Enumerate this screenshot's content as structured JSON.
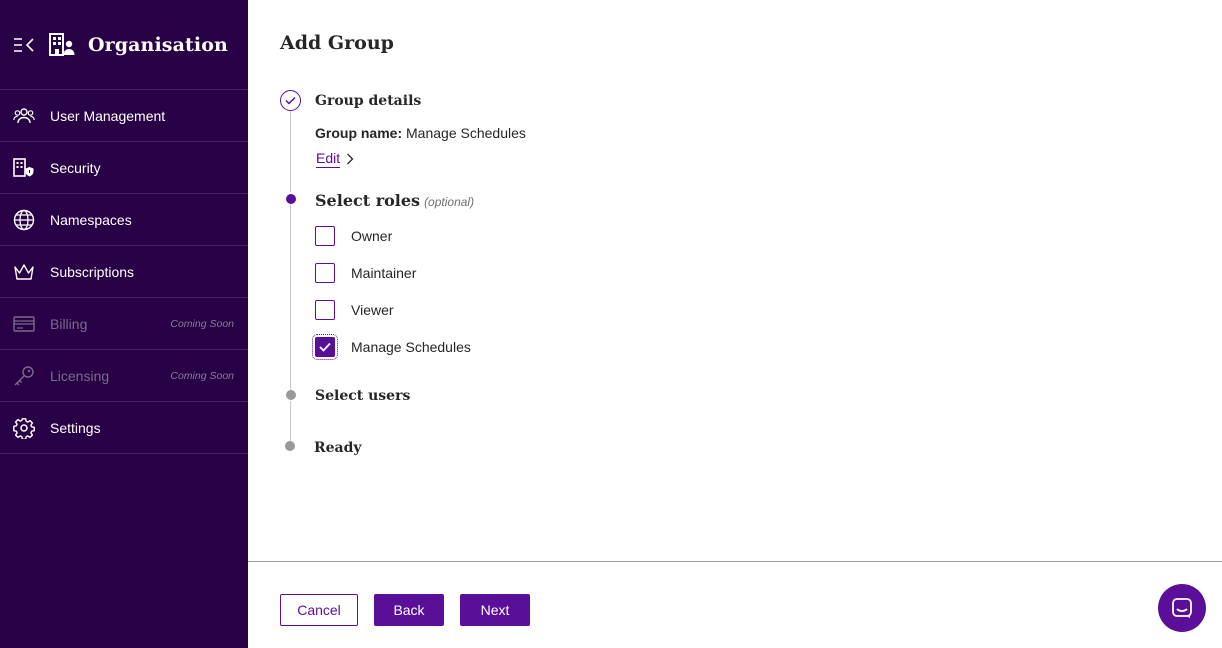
{
  "sidebar": {
    "title": "Organisation",
    "items": [
      {
        "label": "User Management",
        "icon": "users-icon",
        "disabled": false,
        "badge": ""
      },
      {
        "label": "Security",
        "icon": "building-shield-icon",
        "disabled": false,
        "badge": ""
      },
      {
        "label": "Namespaces",
        "icon": "globe-icon",
        "disabled": false,
        "badge": ""
      },
      {
        "label": "Subscriptions",
        "icon": "crown-icon",
        "disabled": false,
        "badge": ""
      },
      {
        "label": "Billing",
        "icon": "credit-card-icon",
        "disabled": true,
        "badge": "Coming Soon"
      },
      {
        "label": "Licensing",
        "icon": "key-icon",
        "disabled": true,
        "badge": "Coming Soon"
      },
      {
        "label": "Settings",
        "icon": "gear-icon",
        "disabled": false,
        "badge": ""
      }
    ]
  },
  "page": {
    "title": "Add Group"
  },
  "steps": {
    "group_details": {
      "title": "Group details",
      "group_name_label": "Group name:",
      "group_name_value": "Manage Schedules",
      "edit_label": "Edit"
    },
    "select_roles": {
      "title": "Select roles",
      "optional_label": "(optional)",
      "roles": [
        {
          "label": "Owner",
          "checked": false
        },
        {
          "label": "Maintainer",
          "checked": false
        },
        {
          "label": "Viewer",
          "checked": false
        },
        {
          "label": "Manage Schedules",
          "checked": true
        }
      ]
    },
    "select_users": {
      "title": "Select users"
    },
    "ready": {
      "title": "Ready"
    }
  },
  "footer": {
    "cancel_label": "Cancel",
    "back_label": "Back",
    "next_label": "Next"
  },
  "colors": {
    "sidebar_bg": "#280045",
    "accent": "#5a0f99",
    "pending_dot": "#999999"
  }
}
